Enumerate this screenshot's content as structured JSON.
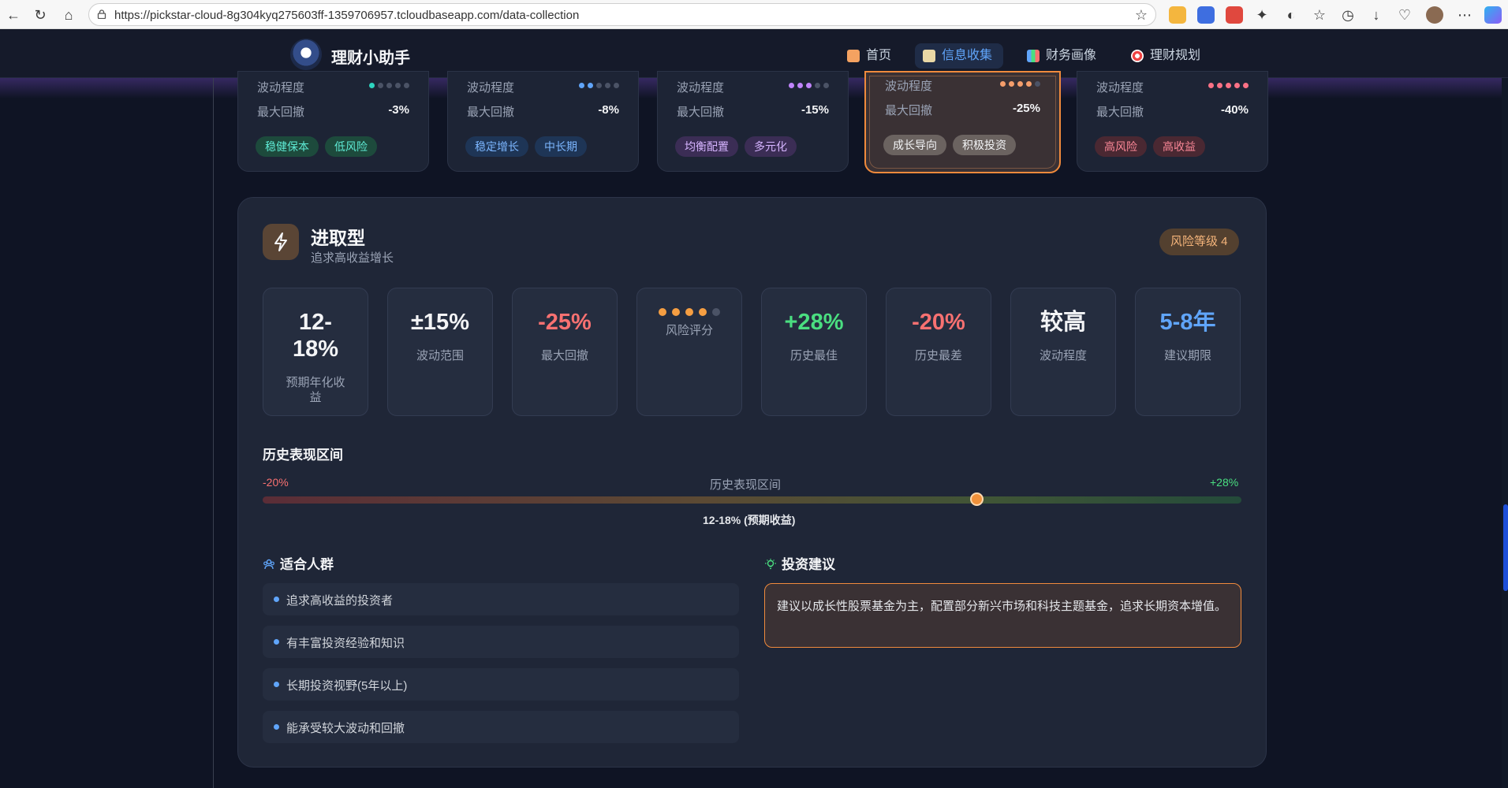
{
  "browser": {
    "url": "https://pickstar-cloud-8g304kyq275603ff-1359706957.tcloudbaseapp.com/data-collection"
  },
  "header": {
    "brand": "理财小助手",
    "nav": [
      {
        "label": "首页",
        "icon": "home-icon",
        "active": false
      },
      {
        "label": "信息收集",
        "icon": "clipboard-icon",
        "active": true
      },
      {
        "label": "财务画像",
        "icon": "bar-chart-icon",
        "active": false
      },
      {
        "label": "理财规划",
        "icon": "target-icon",
        "active": false
      }
    ]
  },
  "type_cards": [
    {
      "vol_label": "波动程度",
      "vol_dots": 1,
      "dot_color": "#2dd4bf",
      "dd_label": "最大回撤",
      "dd_value": "-3%",
      "tags": [
        "稳健保本",
        "低风险"
      ],
      "tag_bg": "#1d4a3c",
      "tag_fg": "#5eead4"
    },
    {
      "vol_label": "波动程度",
      "vol_dots": 2,
      "dot_color": "#60a5fa",
      "dd_label": "最大回撤",
      "dd_value": "-8%",
      "tags": [
        "稳定增长",
        "中长期"
      ],
      "tag_bg": "#1e3556",
      "tag_fg": "#7cb6ff"
    },
    {
      "vol_label": "波动程度",
      "vol_dots": 3,
      "dot_color": "#c084fc",
      "dd_label": "最大回撤",
      "dd_value": "-15%",
      "tags": [
        "均衡配置",
        "多元化"
      ],
      "tag_bg": "#3b2d55",
      "tag_fg": "#d6b4ff"
    },
    {
      "vol_label": "波动程度",
      "vol_dots": 4,
      "dot_color": "#f59e6b",
      "dd_label": "最大回撤",
      "dd_value": "-25%",
      "tags": [
        "成长导向",
        "积极投资"
      ],
      "tag_bg": "#6b6360",
      "tag_fg": "#f3f4f6",
      "selected": true
    },
    {
      "vol_label": "波动程度",
      "vol_dots": 5,
      "dot_color": "#fb7185",
      "dd_label": "最大回撤",
      "dd_value": "-40%",
      "tags": [
        "高风险",
        "高收益"
      ],
      "tag_bg": "#4a2832",
      "tag_fg": "#fb8797"
    }
  ],
  "panel": {
    "title": "进取型",
    "subtitle": "追求高收益增长",
    "risk_badge": "风险等级 4",
    "stats": [
      {
        "value": "12-18%",
        "label": "预期年化收益",
        "color": "#f3f4f6"
      },
      {
        "value": "±15%",
        "label": "波动范围",
        "color": "#f3f4f6"
      },
      {
        "value": "-25%",
        "label": "最大回撤",
        "color": "#f87171"
      },
      {
        "value": "",
        "label": "风险评分",
        "score": 4,
        "max": 5,
        "color": "#f59e42"
      },
      {
        "value": "+28%",
        "label": "历史最佳",
        "color": "#4ade80"
      },
      {
        "value": "-20%",
        "label": "历史最差",
        "color": "#f87171"
      },
      {
        "value": "较高",
        "label": "波动程度",
        "color": "#f3f4f6"
      },
      {
        "value": "5-8年",
        "label": "建议期限",
        "color": "#60a5fa"
      }
    ],
    "range": {
      "title": "历史表现区间",
      "min_label": "-20%",
      "center_label": "历史表现区间",
      "max_label": "+28%",
      "min": -20,
      "max": 28,
      "marker_value": 15,
      "caption": "12-18% (预期收益)"
    },
    "audience": {
      "title": "适合人群",
      "items": [
        "追求高收益的投资者",
        "有丰富投资经验和知识",
        "长期投资视野(5年以上)",
        "能承受较大波动和回撤"
      ]
    },
    "advice": {
      "title": "投资建议",
      "text": "建议以成长性股票基金为主，配置部分新兴市场和科技主题基金，追求长期资本增值。"
    }
  }
}
